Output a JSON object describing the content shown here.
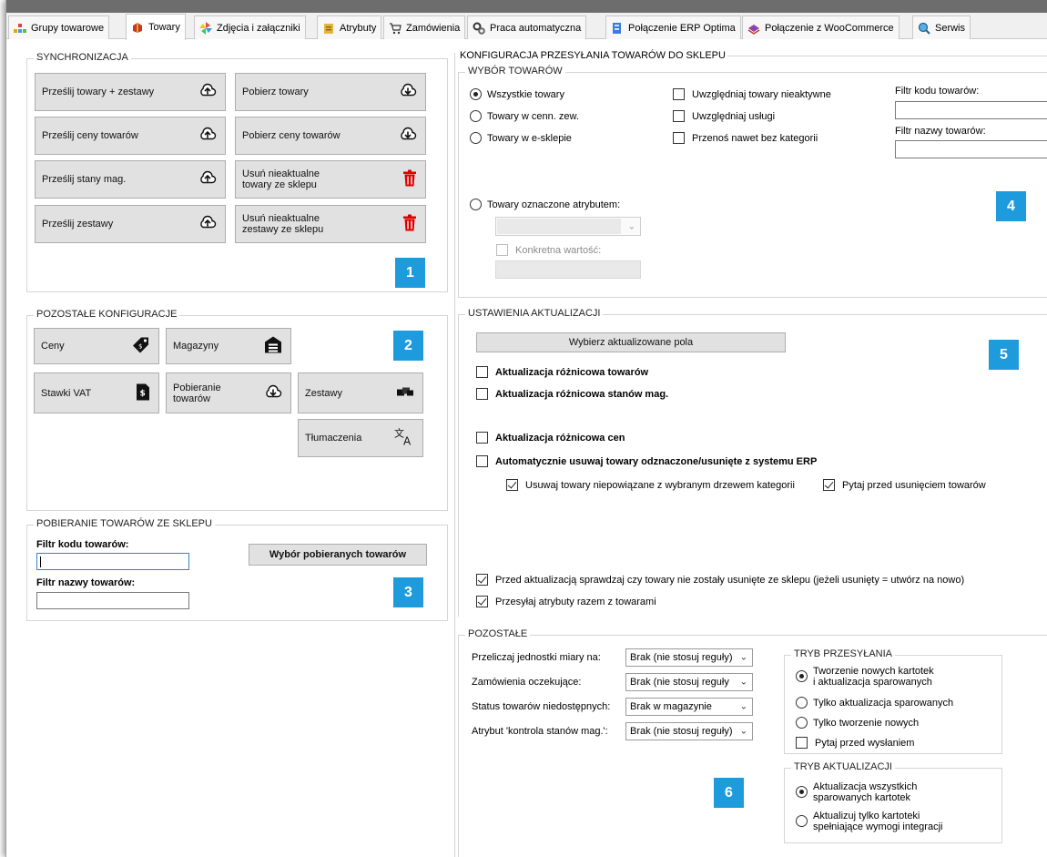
{
  "tabs": [
    {
      "label": "Grupy towarowe",
      "icon": "category-grid-icon"
    },
    {
      "label": "Towary",
      "icon": "products-icon",
      "active": true
    },
    {
      "label": "Zdjęcia i załączniki",
      "icon": "pinwheel-icon"
    },
    {
      "label": "Atrybuty",
      "icon": "attributes-icon"
    },
    {
      "label": "Zamówienia",
      "icon": "cart-icon"
    },
    {
      "label": "Praca automatyczna",
      "icon": "gears-icon"
    },
    {
      "label": "Połączenie ERP Optima",
      "icon": "erp-icon"
    },
    {
      "label": "Połączenie z WooCommerce",
      "icon": "woocommerce-icon"
    },
    {
      "label": "Serwis",
      "icon": "magnifier-icon"
    }
  ],
  "sync": {
    "title": "SYNCHRONIZACJA",
    "buttons": {
      "send_products": "Prześlij towary + zestawy",
      "get_products": "Pobierz towary",
      "send_prices": "Prześlij ceny towarów",
      "get_prices": "Pobierz ceny towarów",
      "send_stock": "Prześlij stany mag.",
      "remove_products": "Usuń nieaktualne\ntowary ze sklepu",
      "send_sets": "Prześlij zestawy",
      "remove_sets": "Usuń nieaktualne\nzestawy ze sklepu"
    },
    "badge": "1"
  },
  "other_config": {
    "title": "POZOSTAŁE KONFIGURACJE",
    "buttons": {
      "prices": "Ceny",
      "warehouses": "Magazyny",
      "vat": "Stawki VAT",
      "download": "Pobieranie\ntowarów",
      "sets": "Zestawy",
      "translations": "Tłumaczenia"
    },
    "badge": "2"
  },
  "download_section": {
    "title": "POBIERANIE TOWARÓW ZE SKLEPU",
    "code_filter_label": "Filtr kodu towarów:",
    "name_filter_label": "Filtr nazwy towarów:",
    "code_filter_value": "",
    "name_filter_value": "",
    "select_button": "Wybór pobieranych towarów",
    "badge": "3"
  },
  "config": {
    "title": "KONFIGURACJA PRZESYŁANIA TOWARÓW DO SKLEPU",
    "selection": {
      "title": "WYBÓR TOWARÓW",
      "radios": [
        "Wszystkie towary",
        "Towary w cenn. zew.",
        "Towary w e-sklepie"
      ],
      "checks": [
        "Uwzględniaj towary nieaktywne",
        "Uwzględniaj usługi",
        "Przenoś nawet bez kategorii"
      ],
      "code_filter_label": "Filtr kodu towarów:",
      "name_filter_label": "Filtr nazwy towarów:",
      "attr_radio": "Towary oznaczone atrybutem:",
      "specific_value": "Konkretna wartość:",
      "badge": "4"
    },
    "update": {
      "title": "USTAWIENIA AKTUALIZACJI",
      "choose_fields": "Wybierz aktualizowane pola",
      "diff_products": "Aktualizacja różnicowa towarów",
      "diff_stock": "Aktualizacja różnicowa stanów mag.",
      "diff_prices": "Aktualizacja różnicowa cen",
      "auto_remove": "Automatycznie usuwaj towary odznaczone/usunięte z systemu ERP",
      "remove_unlinked": "Usuwaj towary niepowiązane z wybranym drzewem kategorii",
      "ask_before_remove": "Pytaj przed usunięciem towarów",
      "check_removed": "Przed aktualizacją sprawdzaj czy towary nie zostały usunięte ze sklepu (jeżeli usunięty = utwórz na nowo)",
      "send_attributes": "Przesyłaj atrybuty razem z towarami",
      "badge": "5"
    },
    "other": {
      "title": "POZOSTAŁE",
      "rows": [
        {
          "label": "Przeliczaj jednostki miary na:",
          "value": "Brak (nie stosuj reguły)"
        },
        {
          "label": "Zamówienia oczekujące:",
          "value": "Brak (nie stosuj reguły"
        },
        {
          "label": "Status towarów niedostępnych:",
          "value": "Brak w magazynie"
        },
        {
          "label": "Atrybut 'kontrola stanów mag.':",
          "value": "Brak (nie stosuj reguły)"
        }
      ],
      "send_mode": {
        "title": "TRYB PRZESYŁANIA",
        "opt1": "Tworzenie nowych kartotek\ni aktualizacja sparowanych",
        "opt2": "Tylko aktualizacja sparowanych",
        "opt3": "Tylko tworzenie nowych",
        "ask": "Pytaj przed wysłaniem"
      },
      "update_mode": {
        "title": "TRYB AKTUALIZACJI",
        "opt1": "Aktualizacja wszystkich\nsparowanych kartotek",
        "opt2": "Aktualizuj tylko kartoteki\nspełniające wymogi integracji"
      },
      "badge": "6"
    }
  }
}
